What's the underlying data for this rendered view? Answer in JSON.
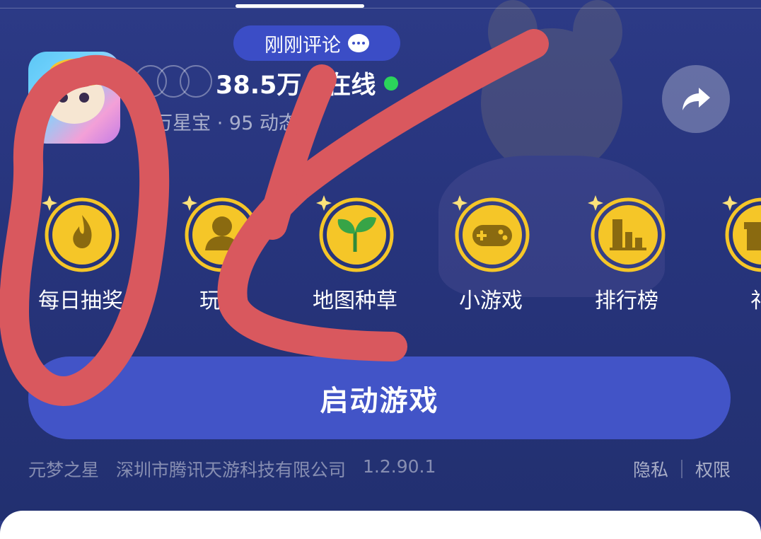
{
  "comment_pill": {
    "label": "刚刚评论",
    "icon": "chat-bubble-icon"
  },
  "header": {
    "online_count": "38.5万人在线",
    "stats": "3万星宝 · 95 动态 ›"
  },
  "features": [
    {
      "label": "每日抽奖",
      "icon": "flame-icon"
    },
    {
      "label": "玩家",
      "icon": "person-icon"
    },
    {
      "label": "地图种草",
      "icon": "sprout-icon"
    },
    {
      "label": "小游戏",
      "icon": "gamepad-icon"
    },
    {
      "label": "排行榜",
      "icon": "bar-chart-icon"
    },
    {
      "label": "礼",
      "icon": "gift-icon"
    }
  ],
  "launch_button": {
    "label": "启动游戏"
  },
  "footer": {
    "game_name": "元梦之星",
    "company": "深圳市腾讯天游科技有限公司",
    "version": "1.2.90.1",
    "privacy": "隐私",
    "permissions": "权限"
  },
  "colors": {
    "background": "#27347c",
    "accent_button": "#4254c7",
    "online_dot": "#2bd45b",
    "medal_gold": "#f5c628",
    "annotation_red": "#d9585e"
  }
}
